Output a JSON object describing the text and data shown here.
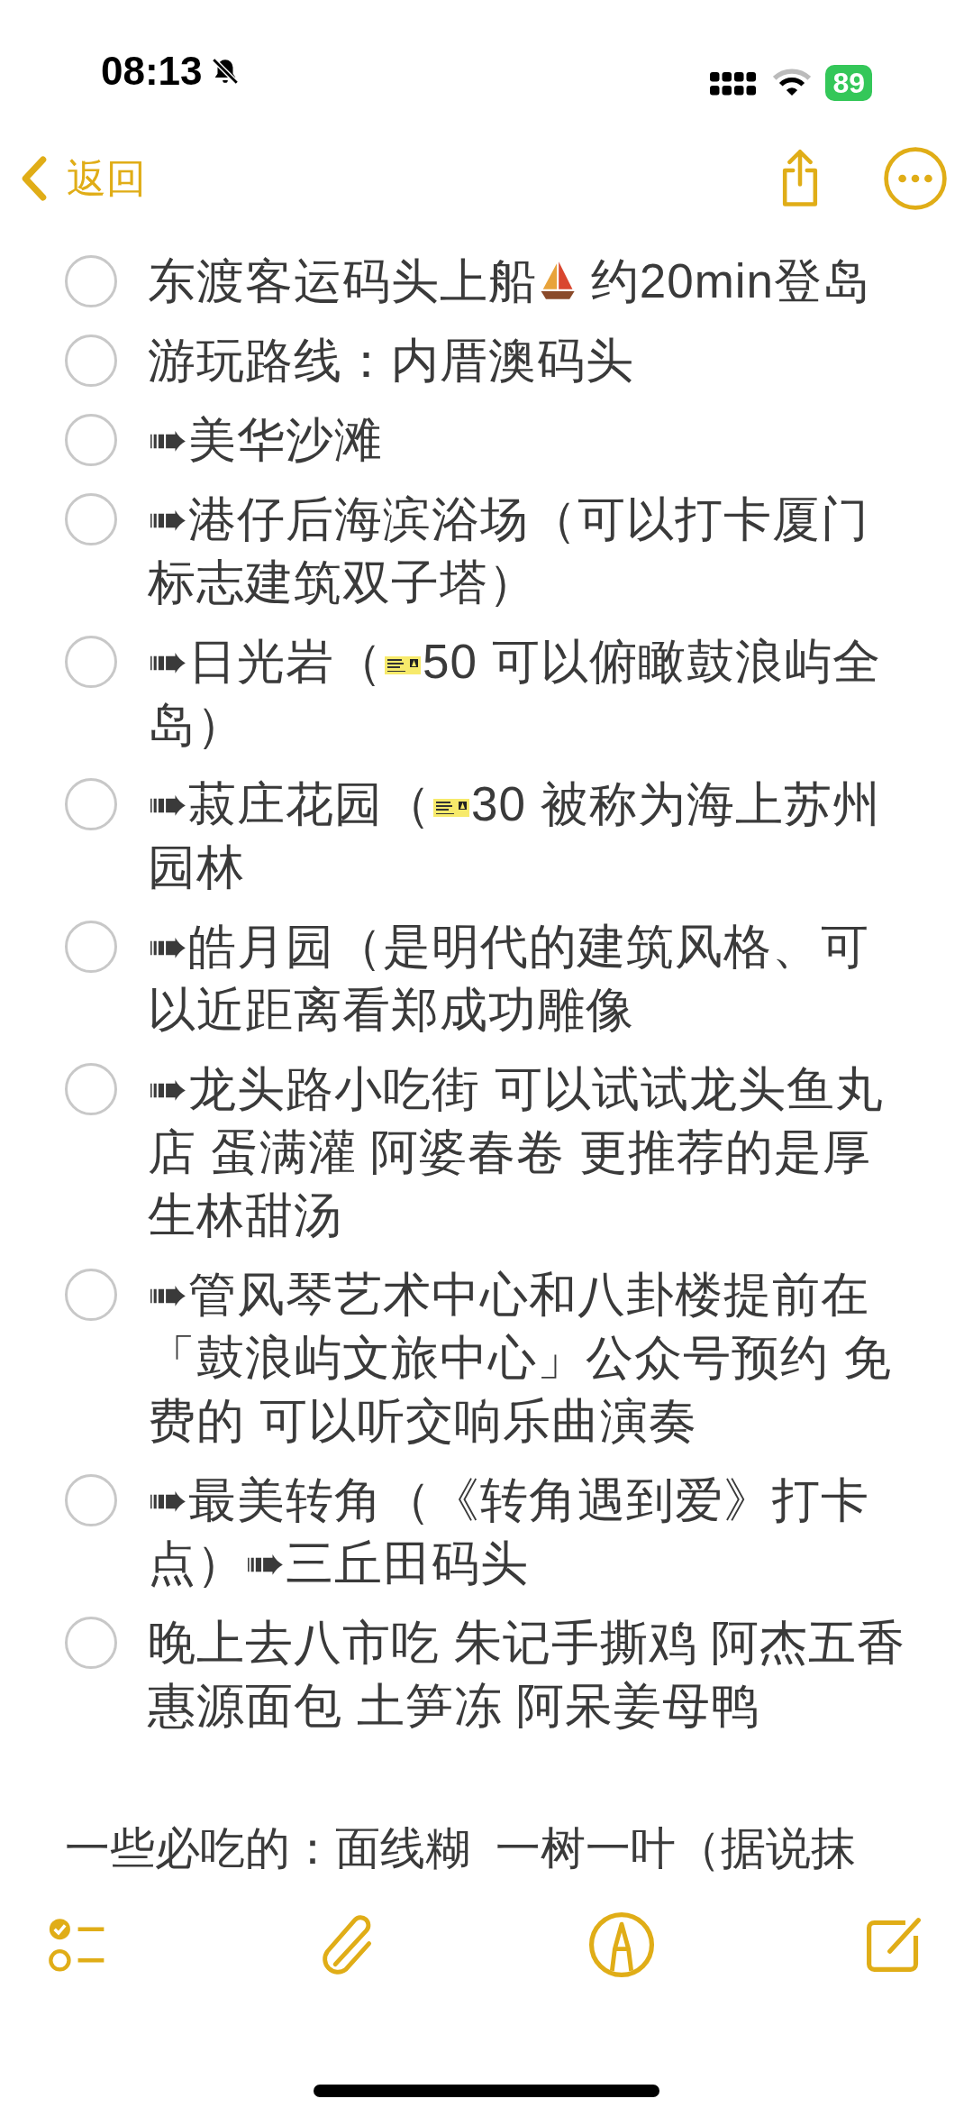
{
  "status_bar": {
    "time": "08:13",
    "battery": "89"
  },
  "nav": {
    "back": "返回"
  },
  "checklist": [
    {
      "checked": false,
      "parts": [
        {
          "kind": "text",
          "text": "东渡客运码头上船"
        },
        {
          "kind": "sailboat"
        },
        {
          "kind": "text",
          "text": " 约20min登岛"
        }
      ]
    },
    {
      "checked": false,
      "parts": [
        {
          "kind": "text",
          "text": "游玩路线：内厝澳码头"
        }
      ]
    },
    {
      "checked": false,
      "parts": [
        {
          "kind": "text",
          "text": "➠美华沙滩"
        }
      ]
    },
    {
      "checked": false,
      "parts": [
        {
          "kind": "text",
          "text": "➠港仔后海滨浴场（可以打卡厦门标志建筑双子塔）"
        }
      ]
    },
    {
      "checked": false,
      "parts": [
        {
          "kind": "text",
          "text": "➠日光岩（"
        },
        {
          "kind": "ticket"
        },
        {
          "kind": "text",
          "text": "50 可以俯瞰鼓浪屿全岛）"
        }
      ]
    },
    {
      "checked": false,
      "parts": [
        {
          "kind": "text",
          "text": "➠菽庄花园（"
        },
        {
          "kind": "ticket"
        },
        {
          "kind": "text",
          "text": "30  被称为海上苏州园林"
        }
      ]
    },
    {
      "checked": false,
      "parts": [
        {
          "kind": "text",
          "text": "➠皓月园（是明代的建筑风格、可以近距离看郑成功雕像"
        }
      ]
    },
    {
      "checked": false,
      "parts": [
        {
          "kind": "text",
          "text": "➠龙头路小吃街 可以试试龙头鱼丸店 蛋满灌 阿婆春卷 更推荐的是厚生林甜汤"
        }
      ]
    },
    {
      "checked": false,
      "parts": [
        {
          "kind": "text",
          "text": "➠管风琴艺术中心和八卦楼提前在「鼓浪屿文旅中心」公众号预约 免费的 可以听交响乐曲演奏"
        }
      ]
    },
    {
      "checked": false,
      "parts": [
        {
          "kind": "text",
          "text": "➠最美转角（《转角遇到爱》打卡点）➠三丘田码头"
        }
      ]
    },
    {
      "checked": false,
      "parts": [
        {
          "kind": "text",
          "text": "晚上去八市吃 朱记手撕鸡 阿杰五香惠源面包 土笋冻 阿呆姜母鸭"
        }
      ]
    }
  ],
  "paragraph": "一些必吃的：面线糊  一树一叶（据说抹"
}
